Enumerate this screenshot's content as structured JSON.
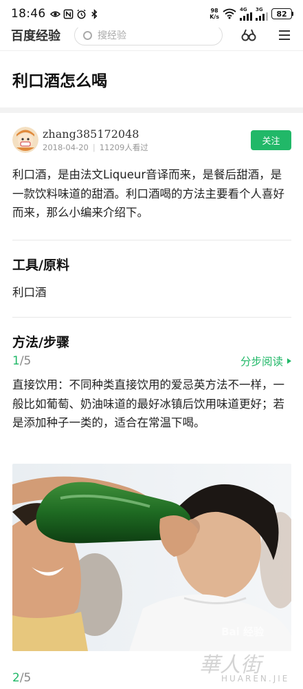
{
  "status_bar": {
    "time": "18:46",
    "net_speed_value": "98",
    "net_speed_unit": "K/s",
    "signal1_tag": "4G",
    "signal2_tag": "3G",
    "battery": "82",
    "left_icons": [
      "eye-icon",
      "nfc-icon",
      "alarm-icon",
      "bluetooth-icon"
    ],
    "right_icons": [
      "wifi-icon",
      "signal-icon",
      "signal-icon"
    ]
  },
  "header": {
    "brand": "百度经验",
    "search_placeholder": "搜经验",
    "icons": [
      "binoculars-icon",
      "menu-icon"
    ]
  },
  "article": {
    "title": "利口酒怎么喝",
    "author": {
      "name": "zhang385172048",
      "date": "2018-04-20",
      "views": "11209人看过",
      "follow_label": "关注"
    },
    "intro": "利口酒，是由法文Liqueur音译而来，是餐后甜酒，是一款饮料味道的甜酒。利口酒喝的方法主要看个人喜好而来，那么小编来介绍下。",
    "tools_heading": "工具/原料",
    "tools": [
      "利口酒"
    ],
    "method_heading": "方法/步骤",
    "read_steps_label": "分步阅读",
    "steps": [
      {
        "index": "1",
        "total": "/5",
        "text": "直接饮用：不同种类直接饮用的爱忌英方法不一样，一般比如葡萄、奶油味道的最好冰镇后饮用味道更好；若是添加种子一类的，适合在常温下喝。"
      },
      {
        "index": "2",
        "total": "/5"
      }
    ],
    "image_watermark": "Bai 经验"
  },
  "page_watermark": {
    "main": "華人街",
    "sub": "HUAREN.JIE"
  },
  "colors": {
    "accent_green": "#21b868",
    "text": "#222222",
    "muted": "#999999"
  }
}
